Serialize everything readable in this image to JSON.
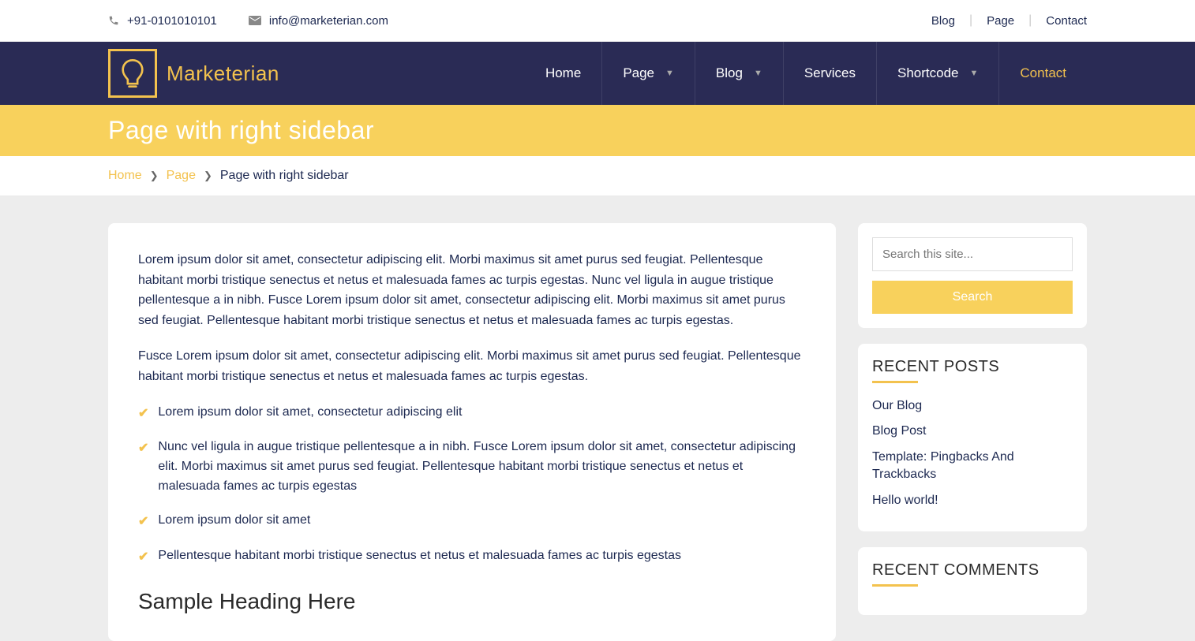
{
  "topbar": {
    "phone": "+91-0101010101",
    "email": "info@marketerian.com",
    "links": [
      "Blog",
      "Page",
      "Contact"
    ]
  },
  "brand": "Marketerian",
  "nav": [
    {
      "label": "Home",
      "dropdown": false
    },
    {
      "label": "Page",
      "dropdown": true
    },
    {
      "label": "Blog",
      "dropdown": true
    },
    {
      "label": "Services",
      "dropdown": false
    },
    {
      "label": "Shortcode",
      "dropdown": true
    },
    {
      "label": "Contact",
      "dropdown": false,
      "highlight": true
    }
  ],
  "page_title": "Page with right sidebar",
  "breadcrumb": {
    "links": [
      "Home",
      "Page"
    ],
    "current": "Page with right sidebar"
  },
  "content": {
    "para1": "Lorem ipsum dolor sit amet, consectetur adipiscing elit. Morbi maximus sit amet purus sed feugiat. Pellentesque habitant morbi tristique senectus et netus et malesuada fames ac turpis egestas. Nunc vel ligula in augue tristique pellentesque a in nibh. Fusce Lorem ipsum dolor sit amet, consectetur adipiscing elit. Morbi maximus sit amet purus sed feugiat. Pellentesque habitant morbi tristique senectus et netus et malesuada fames ac turpis egestas.",
    "para2": "Fusce Lorem ipsum dolor sit amet, consectetur adipiscing elit. Morbi maximus sit amet purus sed feugiat. Pellentesque habitant morbi tristique senectus et netus et malesuada fames ac turpis egestas.",
    "list": [
      "Lorem ipsum dolor sit amet, consectetur adipiscing elit",
      "Nunc vel ligula in augue tristique pellentesque a in nibh. Fusce Lorem ipsum dolor sit amet, consectetur adipiscing elit. Morbi maximus sit amet purus sed feugiat. Pellentesque habitant morbi tristique senectus et netus et malesuada fames ac turpis egestas",
      "Lorem ipsum dolor sit amet",
      "Pellentesque habitant morbi tristique senectus et netus et malesuada fames ac turpis egestas"
    ],
    "heading": "Sample Heading Here"
  },
  "sidebar": {
    "search_placeholder": "Search this site...",
    "search_button": "Search",
    "recent_posts_title": "RECENT POSTS",
    "recent_posts": [
      "Our Blog",
      "Blog Post",
      "Template: Pingbacks And Trackbacks",
      "Hello world!"
    ],
    "recent_comments_title": "RECENT COMMENTS"
  }
}
